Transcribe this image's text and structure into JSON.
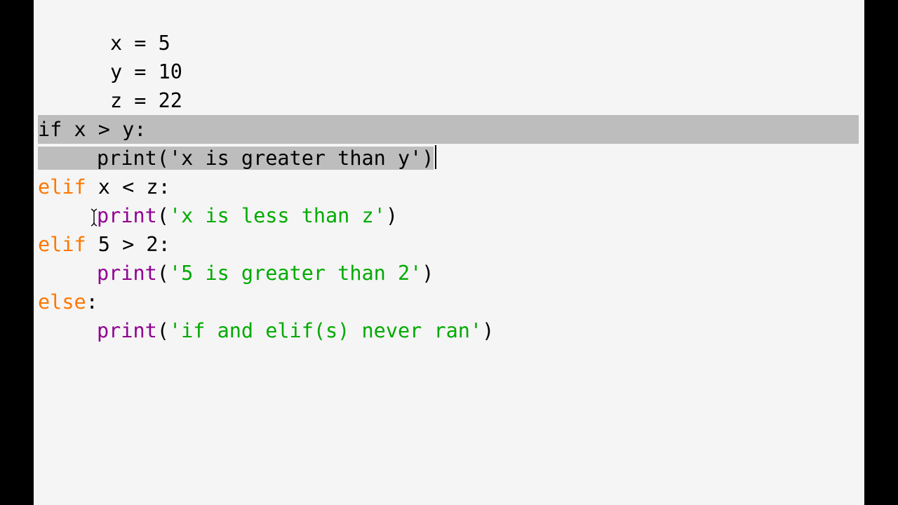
{
  "code": {
    "line1": {
      "text": "x = 5"
    },
    "line2": {
      "text": "y = 10"
    },
    "line3": {
      "text": "z = 22"
    },
    "line5": {
      "kw": "if",
      "rest": " x > y:"
    },
    "line6": {
      "bi": "print",
      "open": "(",
      "str": "'x is greater than y'",
      "close": ")"
    },
    "line7": {
      "kw": "elif",
      "rest": " x < z:"
    },
    "line8": {
      "bi": "print",
      "open": "(",
      "str": "'x is less than z'",
      "close": ")"
    },
    "line9": {
      "kw": "elif",
      "rest": " 5 > 2:"
    },
    "line10": {
      "bi": "print",
      "open": "(",
      "str": "'5 is greater than 2'",
      "close": ")"
    },
    "line11": {
      "kw": "else",
      "rest": ":"
    },
    "line12": {
      "bi": "print",
      "open": "(",
      "str": "'if and elif(s) never ran'",
      "close": ")"
    }
  },
  "colors": {
    "keyword": "#ff7700",
    "builtin": "#900090",
    "string": "#00aa00",
    "selection": "#bdbdbd",
    "background": "#f5f5f5"
  },
  "cursor_icon": "text-cursor-icon"
}
